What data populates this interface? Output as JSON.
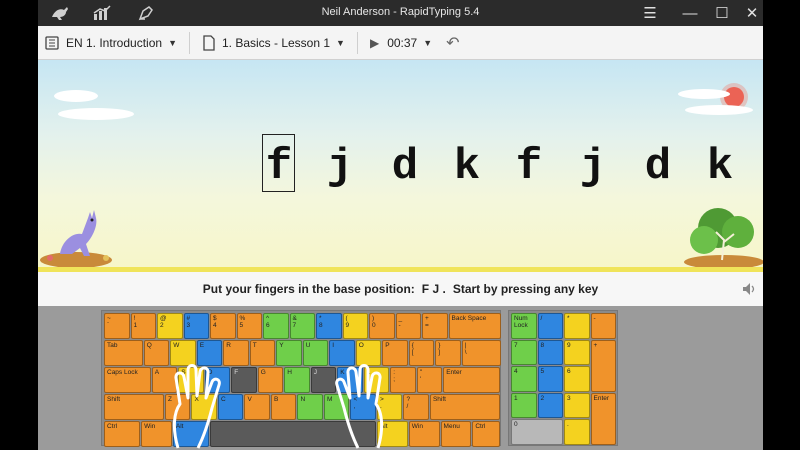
{
  "window": {
    "title": "Neil Anderson - RapidTyping 5.4"
  },
  "titlebar": {
    "icons": [
      "kangaroo-icon",
      "stats-icon",
      "editor-icon"
    ],
    "controls": [
      "menu-icon",
      "minimize-icon",
      "maximize-icon",
      "close-icon"
    ],
    "minimize_glyph": "—",
    "maximize_glyph": "☐",
    "close_glyph": "✕",
    "menu_glyph": "☰"
  },
  "toolbar": {
    "course": "EN 1. Introduction",
    "lesson": "1. Basics - Lesson 1",
    "time": "00:37",
    "play_glyph": "▶",
    "undo_glyph": "↶",
    "caret": "▼"
  },
  "exercise": {
    "letters": [
      "f",
      "j",
      "d",
      "k",
      "f",
      "j",
      "d",
      "k"
    ],
    "current_index": 0
  },
  "hint": {
    "prefix": "Put your fingers in the base position:",
    "keys": "F J .",
    "suffix": "Start by pressing any key",
    "speaker_glyph": "🔈"
  },
  "keyboard": {
    "row1": [
      {
        "top": "~",
        "bot": "`",
        "c": "o"
      },
      {
        "top": "!",
        "bot": "1",
        "c": "o"
      },
      {
        "top": "@",
        "bot": "2",
        "c": "y"
      },
      {
        "top": "#",
        "bot": "3",
        "c": "b"
      },
      {
        "top": "$",
        "bot": "4",
        "c": "o"
      },
      {
        "top": "%",
        "bot": "5",
        "c": "o"
      },
      {
        "top": "^",
        "bot": "6",
        "c": "g"
      },
      {
        "top": "&",
        "bot": "7",
        "c": "g"
      },
      {
        "top": "*",
        "bot": "8",
        "c": "b"
      },
      {
        "top": "(",
        "bot": "9",
        "c": "y"
      },
      {
        "top": ")",
        "bot": "0",
        "c": "o"
      },
      {
        "top": "_",
        "bot": "-",
        "c": "o"
      },
      {
        "top": "+",
        "bot": "=",
        "c": "o"
      },
      {
        "top": "Back Space",
        "bot": "",
        "c": "o",
        "w": 2
      }
    ],
    "row2": [
      {
        "top": "Tab",
        "bot": "",
        "c": "o",
        "w": 1.5
      },
      {
        "top": "Q",
        "bot": "",
        "c": "o"
      },
      {
        "top": "W",
        "bot": "",
        "c": "y"
      },
      {
        "top": "E",
        "bot": "",
        "c": "b"
      },
      {
        "top": "R",
        "bot": "",
        "c": "o"
      },
      {
        "top": "T",
        "bot": "",
        "c": "o"
      },
      {
        "top": "Y",
        "bot": "",
        "c": "g"
      },
      {
        "top": "U",
        "bot": "",
        "c": "g"
      },
      {
        "top": "I",
        "bot": "",
        "c": "b"
      },
      {
        "top": "O",
        "bot": "",
        "c": "y"
      },
      {
        "top": "P",
        "bot": "",
        "c": "o"
      },
      {
        "top": "{",
        "bot": "[",
        "c": "o"
      },
      {
        "top": "}",
        "bot": "]",
        "c": "o"
      },
      {
        "top": "|",
        "bot": "\\",
        "c": "o",
        "w": 1.5
      }
    ],
    "row3": [
      {
        "top": "Caps Lock",
        "bot": "",
        "c": "o",
        "w": 1.8
      },
      {
        "top": "A",
        "bot": "",
        "c": "o"
      },
      {
        "top": "S",
        "bot": "",
        "c": "y"
      },
      {
        "top": "D",
        "bot": "",
        "c": "b"
      },
      {
        "top": "F",
        "bot": "",
        "c": "d"
      },
      {
        "top": "G",
        "bot": "",
        "c": "o"
      },
      {
        "top": "H",
        "bot": "",
        "c": "g"
      },
      {
        "top": "J",
        "bot": "",
        "c": "d"
      },
      {
        "top": "K",
        "bot": "",
        "c": "b"
      },
      {
        "top": "L",
        "bot": "",
        "c": "y"
      },
      {
        "top": ":",
        "bot": ";",
        "c": "o"
      },
      {
        "top": "\"",
        "bot": "'",
        "c": "o"
      },
      {
        "top": "Enter",
        "bot": "",
        "c": "o",
        "w": 2.2
      }
    ],
    "row4": [
      {
        "top": "Shift",
        "bot": "",
        "c": "o",
        "w": 2.3
      },
      {
        "top": "Z",
        "bot": "",
        "c": "o"
      },
      {
        "top": "X",
        "bot": "",
        "c": "y"
      },
      {
        "top": "C",
        "bot": "",
        "c": "b"
      },
      {
        "top": "V",
        "bot": "",
        "c": "o"
      },
      {
        "top": "B",
        "bot": "",
        "c": "o"
      },
      {
        "top": "N",
        "bot": "",
        "c": "g"
      },
      {
        "top": "M",
        "bot": "",
        "c": "g"
      },
      {
        "top": "<",
        "bot": ",",
        "c": "b"
      },
      {
        "top": ">",
        "bot": ".",
        "c": "y"
      },
      {
        "top": "?",
        "bot": "/",
        "c": "o"
      },
      {
        "top": "Shift",
        "bot": "",
        "c": "o",
        "w": 2.7
      }
    ],
    "row5": [
      {
        "top": "Ctrl",
        "bot": "",
        "c": "o",
        "w": 1.4
      },
      {
        "top": "Win",
        "bot": "",
        "c": "o",
        "w": 1.2
      },
      {
        "top": "Alt",
        "bot": "",
        "c": "b",
        "w": 1.4
      },
      {
        "top": "",
        "bot": "",
        "c": "d",
        "w": 6.3
      },
      {
        "top": "Alt",
        "bot": "",
        "c": "y",
        "w": 1.2
      },
      {
        "top": "Win",
        "bot": "",
        "c": "o",
        "w": 1.2
      },
      {
        "top": "Menu",
        "bot": "",
        "c": "o",
        "w": 1.2
      },
      {
        "top": "Ctrl",
        "bot": "",
        "c": "o",
        "w": 1.1
      }
    ]
  },
  "numpad": {
    "keys": [
      {
        "top": "Num Lock",
        "c": "g",
        "x": 0,
        "y": 0,
        "w": 1,
        "h": 1
      },
      {
        "top": "/",
        "c": "b",
        "x": 1,
        "y": 0,
        "w": 1,
        "h": 1
      },
      {
        "top": "*",
        "c": "y",
        "x": 2,
        "y": 0,
        "w": 1,
        "h": 1
      },
      {
        "top": "-",
        "c": "o",
        "x": 3,
        "y": 0,
        "w": 1,
        "h": 1
      },
      {
        "top": "7",
        "c": "g",
        "x": 0,
        "y": 1,
        "w": 1,
        "h": 1
      },
      {
        "top": "8",
        "c": "b",
        "x": 1,
        "y": 1,
        "w": 1,
        "h": 1
      },
      {
        "top": "9",
        "c": "y",
        "x": 2,
        "y": 1,
        "w": 1,
        "h": 1
      },
      {
        "top": "+",
        "c": "o",
        "x": 3,
        "y": 1,
        "w": 1,
        "h": 2
      },
      {
        "top": "4",
        "c": "g",
        "x": 0,
        "y": 2,
        "w": 1,
        "h": 1
      },
      {
        "top": "5",
        "c": "b",
        "x": 1,
        "y": 2,
        "w": 1,
        "h": 1
      },
      {
        "top": "6",
        "c": "y",
        "x": 2,
        "y": 2,
        "w": 1,
        "h": 1
      },
      {
        "top": "1",
        "c": "g",
        "x": 0,
        "y": 3,
        "w": 1,
        "h": 1
      },
      {
        "top": "2",
        "c": "b",
        "x": 1,
        "y": 3,
        "w": 1,
        "h": 1
      },
      {
        "top": "3",
        "c": "y",
        "x": 2,
        "y": 3,
        "w": 1,
        "h": 1
      },
      {
        "top": "Enter",
        "c": "o",
        "x": 3,
        "y": 3,
        "w": 1,
        "h": 2
      },
      {
        "top": "0",
        "c": "s",
        "x": 0,
        "y": 4,
        "w": 2,
        "h": 1
      },
      {
        "top": ".",
        "c": "y",
        "x": 2,
        "y": 4,
        "w": 1,
        "h": 1
      }
    ]
  },
  "colors": {
    "orange": "#f0932b",
    "blue": "#2f86e0",
    "yellow": "#f4d21f",
    "green": "#6fcf4a"
  }
}
